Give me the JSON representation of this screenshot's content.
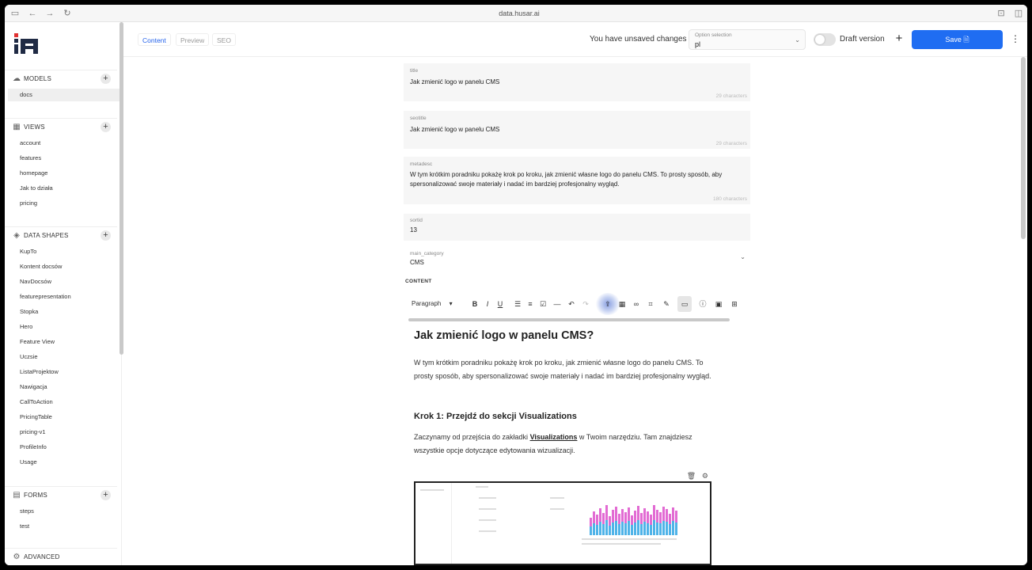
{
  "browser": {
    "url": "data.husar.ai"
  },
  "sidebar": {
    "sections": {
      "models": {
        "title": "MODELS",
        "items": [
          "docs"
        ]
      },
      "views": {
        "title": "VIEWS",
        "items": [
          "account",
          "features",
          "homepage",
          "Jak to działa",
          "pricing"
        ]
      },
      "data_shapes": {
        "title": "DATA SHAPES",
        "items": [
          "KupTo",
          "Kontent docsów",
          "NavDocsów",
          "featurepresentation",
          "Stopka",
          "Hero",
          "Feature View",
          "Uczsie",
          "ListaProjektow",
          "Nawigacja",
          "CallToAction",
          "PricingTable",
          "pricing-v1",
          "ProfileInfo",
          "Usage"
        ]
      },
      "forms": {
        "title": "FORMS",
        "items": [
          "steps",
          "test"
        ]
      },
      "advanced": {
        "title": "ADVANCED"
      }
    }
  },
  "topbar": {
    "tabs": [
      "Content",
      "Preview",
      "SEO"
    ],
    "unsaved": "You have unsaved changes",
    "option_label": "Option selection",
    "option_value": "pl",
    "draft_label": "Draft version",
    "save_label": "Save"
  },
  "fields": {
    "title": {
      "label": "title",
      "value": "Jak zmienić logo w panelu CMS",
      "count": "29 characters"
    },
    "seotitle": {
      "label": "seotitle",
      "value": "Jak zmienić logo w panelu CMS",
      "count": "29 characters"
    },
    "metadesc": {
      "label": "metadesc",
      "value": "W tym krótkim poradniku pokażę krok po kroku, jak zmienić własne logo do panelu CMS. To prosty sposób, aby spersonalizować swoje materiały i nadać im bardziej profesjonalny wygląd.",
      "count": "180 characters"
    },
    "sortid": {
      "label": "sortid",
      "value": "13"
    },
    "main_category": {
      "label": "main_category",
      "value": "CMS"
    }
  },
  "content": {
    "label": "CONTENT",
    "paragraph_select": "Paragraph",
    "heading": "Jak zmienić logo w panelu CMS?",
    "intro": "W tym krótkim poradniku pokażę krok po kroku, jak zmienić własne logo do panelu CMS. To prosty sposób, aby spersonalizować swoje materiały i nadać im bardziej profesjonalny wygląd.",
    "step1_heading": "Krok 1: Przejdź do sekcji Visualizations",
    "step1_pre": "Zaczynamy od przejścia do zakładki ",
    "step1_bold": "Visualizations",
    "step1_post": " w Twoim narzędziu. Tam znajdziesz wszystkie opcje dotyczące edytowania wizualizacji."
  },
  "colors": {
    "accent": "#1f6df2",
    "field_bg": "#f6f6f6"
  }
}
